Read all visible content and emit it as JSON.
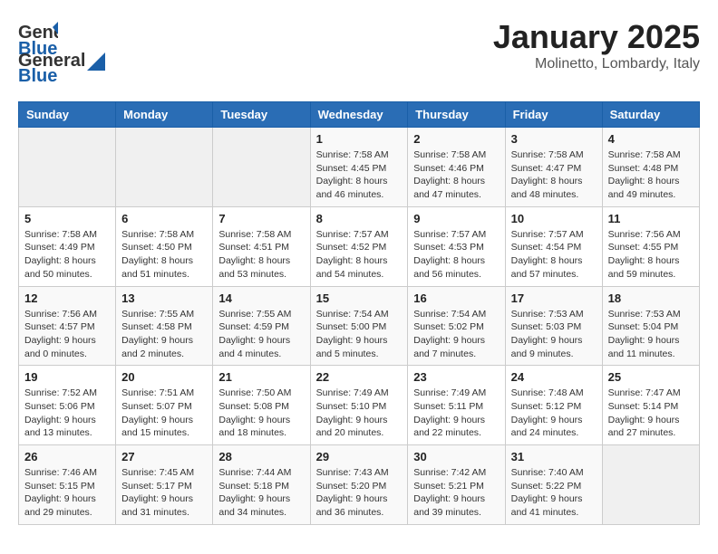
{
  "header": {
    "logo_general": "General",
    "logo_blue": "Blue",
    "month": "January 2025",
    "location": "Molinetto, Lombardy, Italy"
  },
  "weekdays": [
    "Sunday",
    "Monday",
    "Tuesday",
    "Wednesday",
    "Thursday",
    "Friday",
    "Saturday"
  ],
  "weeks": [
    [
      {
        "day": "",
        "info": ""
      },
      {
        "day": "",
        "info": ""
      },
      {
        "day": "",
        "info": ""
      },
      {
        "day": "1",
        "info": "Sunrise: 7:58 AM\nSunset: 4:45 PM\nDaylight: 8 hours and 46 minutes."
      },
      {
        "day": "2",
        "info": "Sunrise: 7:58 AM\nSunset: 4:46 PM\nDaylight: 8 hours and 47 minutes."
      },
      {
        "day": "3",
        "info": "Sunrise: 7:58 AM\nSunset: 4:47 PM\nDaylight: 8 hours and 48 minutes."
      },
      {
        "day": "4",
        "info": "Sunrise: 7:58 AM\nSunset: 4:48 PM\nDaylight: 8 hours and 49 minutes."
      }
    ],
    [
      {
        "day": "5",
        "info": "Sunrise: 7:58 AM\nSunset: 4:49 PM\nDaylight: 8 hours and 50 minutes."
      },
      {
        "day": "6",
        "info": "Sunrise: 7:58 AM\nSunset: 4:50 PM\nDaylight: 8 hours and 51 minutes."
      },
      {
        "day": "7",
        "info": "Sunrise: 7:58 AM\nSunset: 4:51 PM\nDaylight: 8 hours and 53 minutes."
      },
      {
        "day": "8",
        "info": "Sunrise: 7:57 AM\nSunset: 4:52 PM\nDaylight: 8 hours and 54 minutes."
      },
      {
        "day": "9",
        "info": "Sunrise: 7:57 AM\nSunset: 4:53 PM\nDaylight: 8 hours and 56 minutes."
      },
      {
        "day": "10",
        "info": "Sunrise: 7:57 AM\nSunset: 4:54 PM\nDaylight: 8 hours and 57 minutes."
      },
      {
        "day": "11",
        "info": "Sunrise: 7:56 AM\nSunset: 4:55 PM\nDaylight: 8 hours and 59 minutes."
      }
    ],
    [
      {
        "day": "12",
        "info": "Sunrise: 7:56 AM\nSunset: 4:57 PM\nDaylight: 9 hours and 0 minutes."
      },
      {
        "day": "13",
        "info": "Sunrise: 7:55 AM\nSunset: 4:58 PM\nDaylight: 9 hours and 2 minutes."
      },
      {
        "day": "14",
        "info": "Sunrise: 7:55 AM\nSunset: 4:59 PM\nDaylight: 9 hours and 4 minutes."
      },
      {
        "day": "15",
        "info": "Sunrise: 7:54 AM\nSunset: 5:00 PM\nDaylight: 9 hours and 5 minutes."
      },
      {
        "day": "16",
        "info": "Sunrise: 7:54 AM\nSunset: 5:02 PM\nDaylight: 9 hours and 7 minutes."
      },
      {
        "day": "17",
        "info": "Sunrise: 7:53 AM\nSunset: 5:03 PM\nDaylight: 9 hours and 9 minutes."
      },
      {
        "day": "18",
        "info": "Sunrise: 7:53 AM\nSunset: 5:04 PM\nDaylight: 9 hours and 11 minutes."
      }
    ],
    [
      {
        "day": "19",
        "info": "Sunrise: 7:52 AM\nSunset: 5:06 PM\nDaylight: 9 hours and 13 minutes."
      },
      {
        "day": "20",
        "info": "Sunrise: 7:51 AM\nSunset: 5:07 PM\nDaylight: 9 hours and 15 minutes."
      },
      {
        "day": "21",
        "info": "Sunrise: 7:50 AM\nSunset: 5:08 PM\nDaylight: 9 hours and 18 minutes."
      },
      {
        "day": "22",
        "info": "Sunrise: 7:49 AM\nSunset: 5:10 PM\nDaylight: 9 hours and 20 minutes."
      },
      {
        "day": "23",
        "info": "Sunrise: 7:49 AM\nSunset: 5:11 PM\nDaylight: 9 hours and 22 minutes."
      },
      {
        "day": "24",
        "info": "Sunrise: 7:48 AM\nSunset: 5:12 PM\nDaylight: 9 hours and 24 minutes."
      },
      {
        "day": "25",
        "info": "Sunrise: 7:47 AM\nSunset: 5:14 PM\nDaylight: 9 hours and 27 minutes."
      }
    ],
    [
      {
        "day": "26",
        "info": "Sunrise: 7:46 AM\nSunset: 5:15 PM\nDaylight: 9 hours and 29 minutes."
      },
      {
        "day": "27",
        "info": "Sunrise: 7:45 AM\nSunset: 5:17 PM\nDaylight: 9 hours and 31 minutes."
      },
      {
        "day": "28",
        "info": "Sunrise: 7:44 AM\nSunset: 5:18 PM\nDaylight: 9 hours and 34 minutes."
      },
      {
        "day": "29",
        "info": "Sunrise: 7:43 AM\nSunset: 5:20 PM\nDaylight: 9 hours and 36 minutes."
      },
      {
        "day": "30",
        "info": "Sunrise: 7:42 AM\nSunset: 5:21 PM\nDaylight: 9 hours and 39 minutes."
      },
      {
        "day": "31",
        "info": "Sunrise: 7:40 AM\nSunset: 5:22 PM\nDaylight: 9 hours and 41 minutes."
      },
      {
        "day": "",
        "info": ""
      }
    ]
  ]
}
